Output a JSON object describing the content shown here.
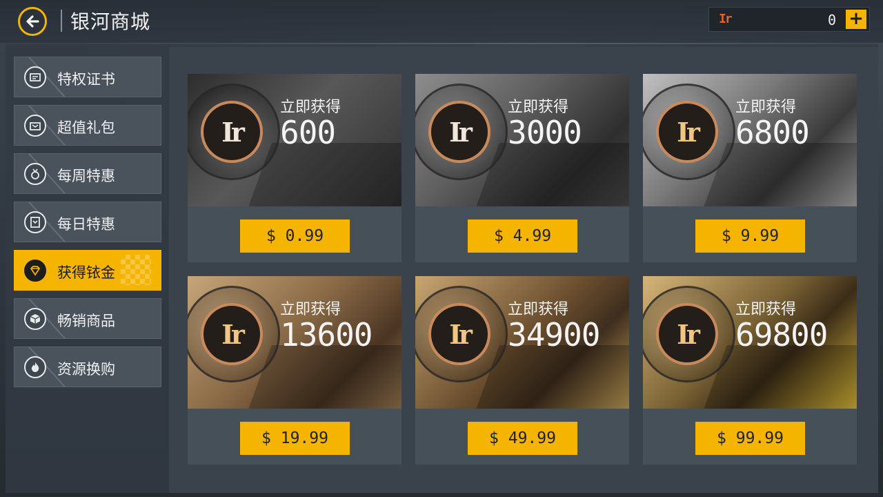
{
  "header": {
    "title": "银河商城",
    "currency_symbol": "Ir",
    "currency_value": "0",
    "add_label": "+"
  },
  "sidebar": {
    "items": [
      {
        "label": "特权证书",
        "icon": "certificate-icon",
        "active": false
      },
      {
        "label": "超值礼包",
        "icon": "gift-box-icon",
        "active": false
      },
      {
        "label": "每周特惠",
        "icon": "medal-icon",
        "active": false
      },
      {
        "label": "每日特惠",
        "icon": "daily-badge-icon",
        "active": false
      },
      {
        "label": "获得铱金",
        "icon": "diamond-icon",
        "active": true
      },
      {
        "label": "畅销商品",
        "icon": "cube-icon",
        "active": false
      },
      {
        "label": "资源换购",
        "icon": "flame-icon",
        "active": false
      }
    ]
  },
  "cards": [
    {
      "caption": "立即获得",
      "amount": "600",
      "price": "$ 0.99",
      "coin_symbol": "Ir"
    },
    {
      "caption": "立即获得",
      "amount": "3000",
      "price": "$ 4.99",
      "coin_symbol": "Ir"
    },
    {
      "caption": "立即获得",
      "amount": "6800",
      "price": "$ 9.99",
      "coin_symbol": "Ir"
    },
    {
      "caption": "立即获得",
      "amount": "13600",
      "price": "$ 19.99",
      "coin_symbol": "Ir"
    },
    {
      "caption": "立即获得",
      "amount": "34900",
      "price": "$ 49.99",
      "coin_symbol": "Ir"
    },
    {
      "caption": "立即获得",
      "amount": "69800",
      "price": "$ 99.99",
      "coin_symbol": "Ir"
    }
  ],
  "colors": {
    "accent": "#f5b400",
    "currency": "#e8602a"
  }
}
